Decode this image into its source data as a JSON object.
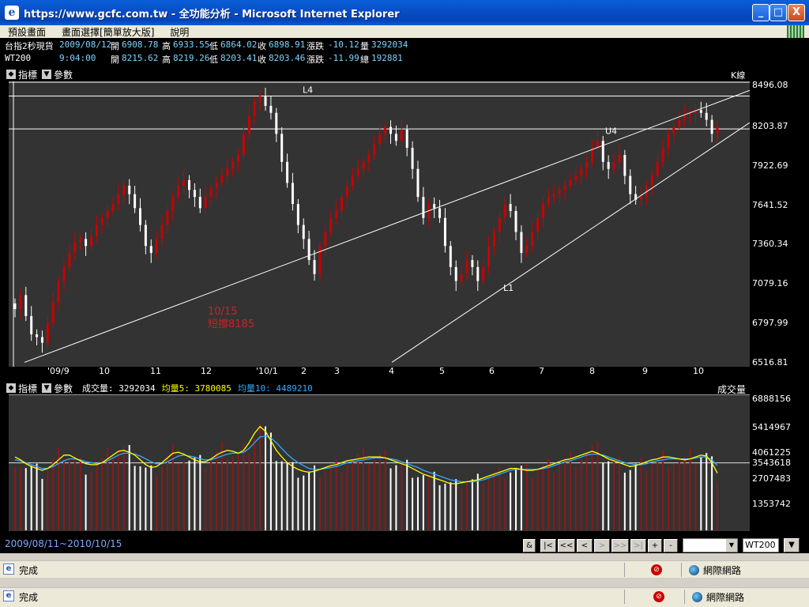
{
  "window": {
    "title": "https://www.gcfc.com.tw - 全功能分析 - Microsoft Internet Explorer",
    "min_label": "_",
    "max_label": "□",
    "close_label": "X"
  },
  "menu": {
    "items": [
      "預設畫面",
      "畫面選擇[簡單放大版]",
      "說明"
    ]
  },
  "quotes": {
    "row1": {
      "name": "台指2秒現貨",
      "date": "2009/08/12",
      "open_label": "開",
      "open": "6908.78",
      "high_label": "高",
      "high": "6933.55",
      "low_label": "低",
      "low": "6864.02",
      "close_label": "收",
      "close": "6898.91",
      "change_label": "漲跌",
      "change": "-10.12",
      "vol_label": "量",
      "vol": "3292034"
    },
    "row2": {
      "name": "WT200",
      "time": "9:04:00",
      "open_label": "開",
      "open": "8215.62",
      "high_label": "高",
      "high": "8219.26",
      "low_label": "低",
      "low": "8203.41",
      "close_label": "收",
      "close": "8203.46",
      "change_label": "漲跌",
      "change": "-11.99",
      "vol_label": "總",
      "vol": "192881"
    }
  },
  "panel1": {
    "indicator_label": "指標",
    "params_label": "參數",
    "k_label": "K線"
  },
  "panel2": {
    "indicator_label": "指標",
    "params_label": "參數",
    "volume_text": "成交量: 3292034",
    "ma5_text": "均量5: 3780085",
    "ma10_text": "均量10: 4489210",
    "right_label": "成交量"
  },
  "colors": {
    "panel_bg": "#333333",
    "up_candle": "#cc0000",
    "down_candle": "#ffffff",
    "ma5": "#ffff00",
    "ma10": "#33aaff",
    "volume_up": "#8b1a1a"
  },
  "chart_data": [
    {
      "type": "candlestick",
      "y_ticks": [
        "8496.08",
        "8203.87",
        "7922.69",
        "7641.52",
        "7360.34",
        "7079.16",
        "6797.99",
        "6516.81"
      ],
      "ylim": [
        6516.81,
        8496.08
      ],
      "x_ticks": [
        "'09/9",
        "10",
        "11",
        "12",
        "'10/1",
        "2",
        "3",
        "4",
        "5",
        "6",
        "7",
        "8",
        "9",
        "10"
      ],
      "annotations": [
        "L4",
        "U4",
        "L1",
        "10/15",
        "短撐8185"
      ],
      "closes": [
        6900,
        7000,
        6850,
        6720,
        6700,
        6660,
        6800,
        6950,
        7100,
        7200,
        7300,
        7380,
        7400,
        7350,
        7420,
        7500,
        7550,
        7600,
        7650,
        7720,
        7780,
        7720,
        7620,
        7500,
        7350,
        7300,
        7400,
        7500,
        7600,
        7700,
        7780,
        7820,
        7750,
        7700,
        7620,
        7700,
        7760,
        7800,
        7850,
        7900,
        7950,
        8000,
        8150,
        8280,
        8380,
        8420,
        8350,
        8300,
        8150,
        7950,
        7800,
        7650,
        7500,
        7400,
        7250,
        7150,
        7350,
        7450,
        7550,
        7600,
        7700,
        7780,
        7850,
        7900,
        7950,
        8000,
        8080,
        8150,
        8200,
        8150,
        8100,
        8180,
        8050,
        7900,
        7700,
        7550,
        7650,
        7620,
        7550,
        7350,
        7200,
        7100,
        7150,
        7250,
        7200,
        7100,
        7200,
        7350,
        7450,
        7550,
        7650,
        7600,
        7450,
        7300,
        7350,
        7450,
        7550,
        7650,
        7700,
        7720,
        7750,
        7780,
        7820,
        7850,
        7900,
        7950,
        8050,
        8100,
        7950,
        7900,
        7950,
        8000,
        7850,
        7720,
        7680,
        7700,
        7780,
        7850,
        7950,
        8050,
        8150,
        8200,
        8250,
        8280,
        8300,
        8320,
        8300,
        8250,
        8150,
        8200
      ]
    },
    {
      "type": "bar",
      "title": "成交量",
      "y_ticks": [
        "6888156",
        "5414967",
        "4061225",
        "3543618",
        "2707483",
        "1353742"
      ],
      "ylim": [
        0,
        6888156
      ],
      "volume": [
        3900,
        3600,
        3300,
        3200,
        3100,
        3000,
        3300,
        3600,
        3900,
        4100,
        3900,
        3700,
        3500,
        3400,
        3300,
        3400,
        3600,
        3800,
        4100,
        4300,
        4200,
        4000,
        3800,
        3500,
        3200,
        3100,
        3300,
        3600,
        3900,
        4200,
        4100,
        3900,
        3700,
        3600,
        3500,
        3600,
        3800,
        4000,
        4200,
        4300,
        4100,
        4000,
        4200,
        4700,
        5200,
        5600,
        5100,
        4500,
        4000,
        3700,
        3400,
        3200,
        3100,
        3000,
        3000,
        3100,
        3200,
        3300,
        3400,
        3500,
        3600,
        3700,
        3700,
        3800,
        3800,
        3900,
        3900,
        3900,
        3800,
        3700,
        3600,
        3500,
        3400,
        3200,
        3000,
        2900,
        2800,
        2700,
        2600,
        2500,
        2400,
        2400,
        2500,
        2600,
        2600,
        2700,
        2800,
        2900,
        3000,
        3100,
        3200,
        3300,
        3300,
        3200,
        3100,
        3100,
        3200,
        3300,
        3400,
        3500,
        3600,
        3700,
        3800,
        3900,
        4000,
        4100,
        4200,
        4100,
        3900,
        3700,
        3600,
        3500,
        3400,
        3300,
        3400,
        3500,
        3600,
        3700,
        3800,
        3900,
        3900,
        3800,
        3700,
        3700,
        3800,
        3900,
        4000,
        3900,
        3500,
        2900
      ],
      "ma5": [
        3850,
        3700,
        3500,
        3350,
        3250,
        3150,
        3250,
        3450,
        3700,
        3950,
        3950,
        3800,
        3650,
        3500,
        3450,
        3450,
        3550,
        3750,
        3950,
        4150,
        4200,
        4100,
        3950,
        3700,
        3450,
        3300,
        3350,
        3550,
        3800,
        4050,
        4100,
        4000,
        3850,
        3700,
        3600,
        3600,
        3750,
        3950,
        4100,
        4200,
        4150,
        4050,
        4200,
        4600,
        5100,
        5450,
        5200,
        4700,
        4200,
        3850,
        3550,
        3350,
        3200,
        3100,
        3050,
        3100,
        3200,
        3300,
        3400,
        3450,
        3550,
        3650,
        3700,
        3750,
        3800,
        3850,
        3850,
        3850,
        3800,
        3700,
        3600,
        3500,
        3400,
        3250,
        3100,
        2950,
        2850,
        2750,
        2650,
        2550,
        2450,
        2450,
        2500,
        2550,
        2600,
        2650,
        2750,
        2850,
        2950,
        3050,
        3150,
        3250,
        3250,
        3200,
        3150,
        3150,
        3200,
        3300,
        3400,
        3500,
        3600,
        3700,
        3750,
        3850,
        3950,
        4050,
        4150,
        4050,
        3900,
        3750,
        3650,
        3550,
        3450,
        3350,
        3400,
        3500,
        3600,
        3700,
        3750,
        3850,
        3850,
        3800,
        3750,
        3700,
        3750,
        3850,
        3950,
        3900,
        3550,
        3000
      ],
      "ma10": [
        3700,
        3650,
        3550,
        3450,
        3350,
        3250,
        3250,
        3350,
        3500,
        3650,
        3750,
        3750,
        3700,
        3600,
        3550,
        3500,
        3550,
        3650,
        3800,
        3950,
        4050,
        4050,
        4000,
        3900,
        3750,
        3600,
        3500,
        3500,
        3600,
        3750,
        3900,
        3950,
        3900,
        3850,
        3750,
        3700,
        3700,
        3800,
        3900,
        4000,
        4050,
        4050,
        4100,
        4300,
        4600,
        4900,
        4950,
        4850,
        4600,
        4300,
        4000,
        3750,
        3550,
        3400,
        3250,
        3200,
        3200,
        3250,
        3300,
        3350,
        3450,
        3550,
        3600,
        3650,
        3700,
        3750,
        3800,
        3800,
        3800,
        3750,
        3700,
        3600,
        3500,
        3400,
        3300,
        3150,
        3050,
        2950,
        2850,
        2750,
        2650,
        2600,
        2550,
        2550,
        2550,
        2600,
        2650,
        2750,
        2850,
        2950,
        3050,
        3150,
        3200,
        3200,
        3200,
        3200,
        3200,
        3250,
        3300,
        3400,
        3500,
        3600,
        3650,
        3750,
        3850,
        3950,
        4000,
        4000,
        3950,
        3850,
        3750,
        3650,
        3550,
        3500,
        3450,
        3450,
        3500,
        3600,
        3650,
        3700,
        3750,
        3750,
        3750,
        3750,
        3750,
        3800,
        3850,
        3850,
        3700,
        3400
      ]
    }
  ],
  "navigation": {
    "date_range": "2009/08/11~2010/10/15",
    "buttons": [
      "&",
      "|<",
      "<<",
      "<",
      ">",
      ">>",
      ">|",
      "+",
      "-"
    ],
    "code_value": "WT200"
  },
  "status_inner": {
    "text": "完成",
    "zone": "網際網路"
  },
  "status_outer": {
    "text": "完成",
    "zone": "網際網路"
  }
}
